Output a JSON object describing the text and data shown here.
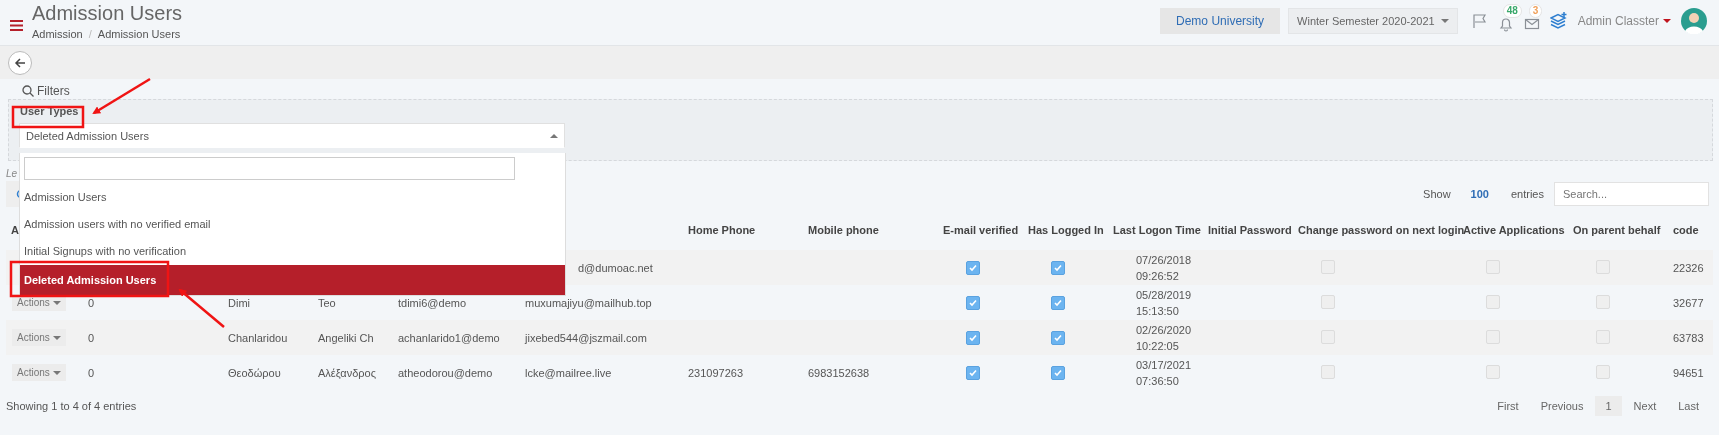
{
  "header": {
    "title": "Admission Users",
    "breadcrumb": [
      "Admission",
      "Admission Users"
    ],
    "breadcrumb_separator": "/",
    "institution": "Demo University",
    "semester": "Winter Semester 2020-2021",
    "notifications": [
      {
        "kind": "bell",
        "count": "48",
        "color": "#3aa86b"
      },
      {
        "kind": "mail",
        "count": "3",
        "color": "#f0a05a"
      }
    ],
    "user": "Admin Classter"
  },
  "filters": {
    "label": "Filters",
    "field_label": "User Types",
    "select": {
      "value": "Deleted Admission Users",
      "expanded": true,
      "options": [
        {
          "label": "Admission Users",
          "selected": false
        },
        {
          "label": "Admission users with no verified email",
          "selected": false
        },
        {
          "label": "Initial Signups with no verification",
          "selected": false
        },
        {
          "label": "Deleted Admission Users",
          "selected": true
        }
      ]
    }
  },
  "legend_label": "Le",
  "table": {
    "show_label": "Show",
    "page_size": "100",
    "entries_label": "entries",
    "search_placeholder": "Search...",
    "columns": [
      "A",
      null,
      null,
      null,
      null,
      null,
      "Home Phone",
      "Mobile phone",
      "E-mail verified",
      "Has Logged In",
      "Last Logon Time",
      "Initial Password",
      "Change password on next login",
      "Active Applications",
      "On parent behalf",
      "code"
    ],
    "rows": [
      {
        "email": "d@dumoac.net",
        "email_verified": true,
        "has_logged_in": true,
        "last_logon": [
          "07/26/2018",
          "09:26:52"
        ],
        "change_password": false,
        "active_applications": false,
        "on_parent_behalf": false,
        "code": "22326"
      },
      {
        "actions": "Actions",
        "count": "0",
        "surname": "Dimi",
        "first_name": "Teo",
        "username": "tdimi6@demo",
        "email": "muxumajiyu@mailhub.top",
        "email_verified": true,
        "has_logged_in": true,
        "last_logon": [
          "05/28/2019",
          "15:13:50"
        ],
        "change_password": false,
        "active_applications": false,
        "on_parent_behalf": false,
        "code": "32677"
      },
      {
        "actions": "Actions",
        "count": "0",
        "surname": "Chanlaridou",
        "first_name": "Angeliki Ch",
        "username": "achanlarido1@demo",
        "email": "jixebed544@jszmail.com",
        "email_verified": true,
        "has_logged_in": true,
        "last_logon": [
          "02/26/2020",
          "10:22:05"
        ],
        "change_password": false,
        "active_applications": false,
        "on_parent_behalf": false,
        "code": "63783"
      },
      {
        "actions": "Actions",
        "count": "0",
        "surname": "Θεοδώρου",
        "first_name": "Αλέξανδρος",
        "username": "atheodorou@demo",
        "email": "lcke@mailree.live",
        "home_phone": "231097263",
        "mobile_phone": "6983152638",
        "email_verified": true,
        "has_logged_in": true,
        "last_logon": [
          "03/17/2021",
          "07:36:50"
        ],
        "change_password": false,
        "active_applications": false,
        "on_parent_behalf": false,
        "code": "94651"
      }
    ],
    "info": "Showing 1 to 4 of 4 entries",
    "pagination": [
      {
        "label": "First",
        "selected": false
      },
      {
        "label": "Previous",
        "selected": false
      },
      {
        "label": "1",
        "selected": true
      },
      {
        "label": "Next",
        "selected": false
      },
      {
        "label": "Last",
        "selected": false
      }
    ]
  }
}
